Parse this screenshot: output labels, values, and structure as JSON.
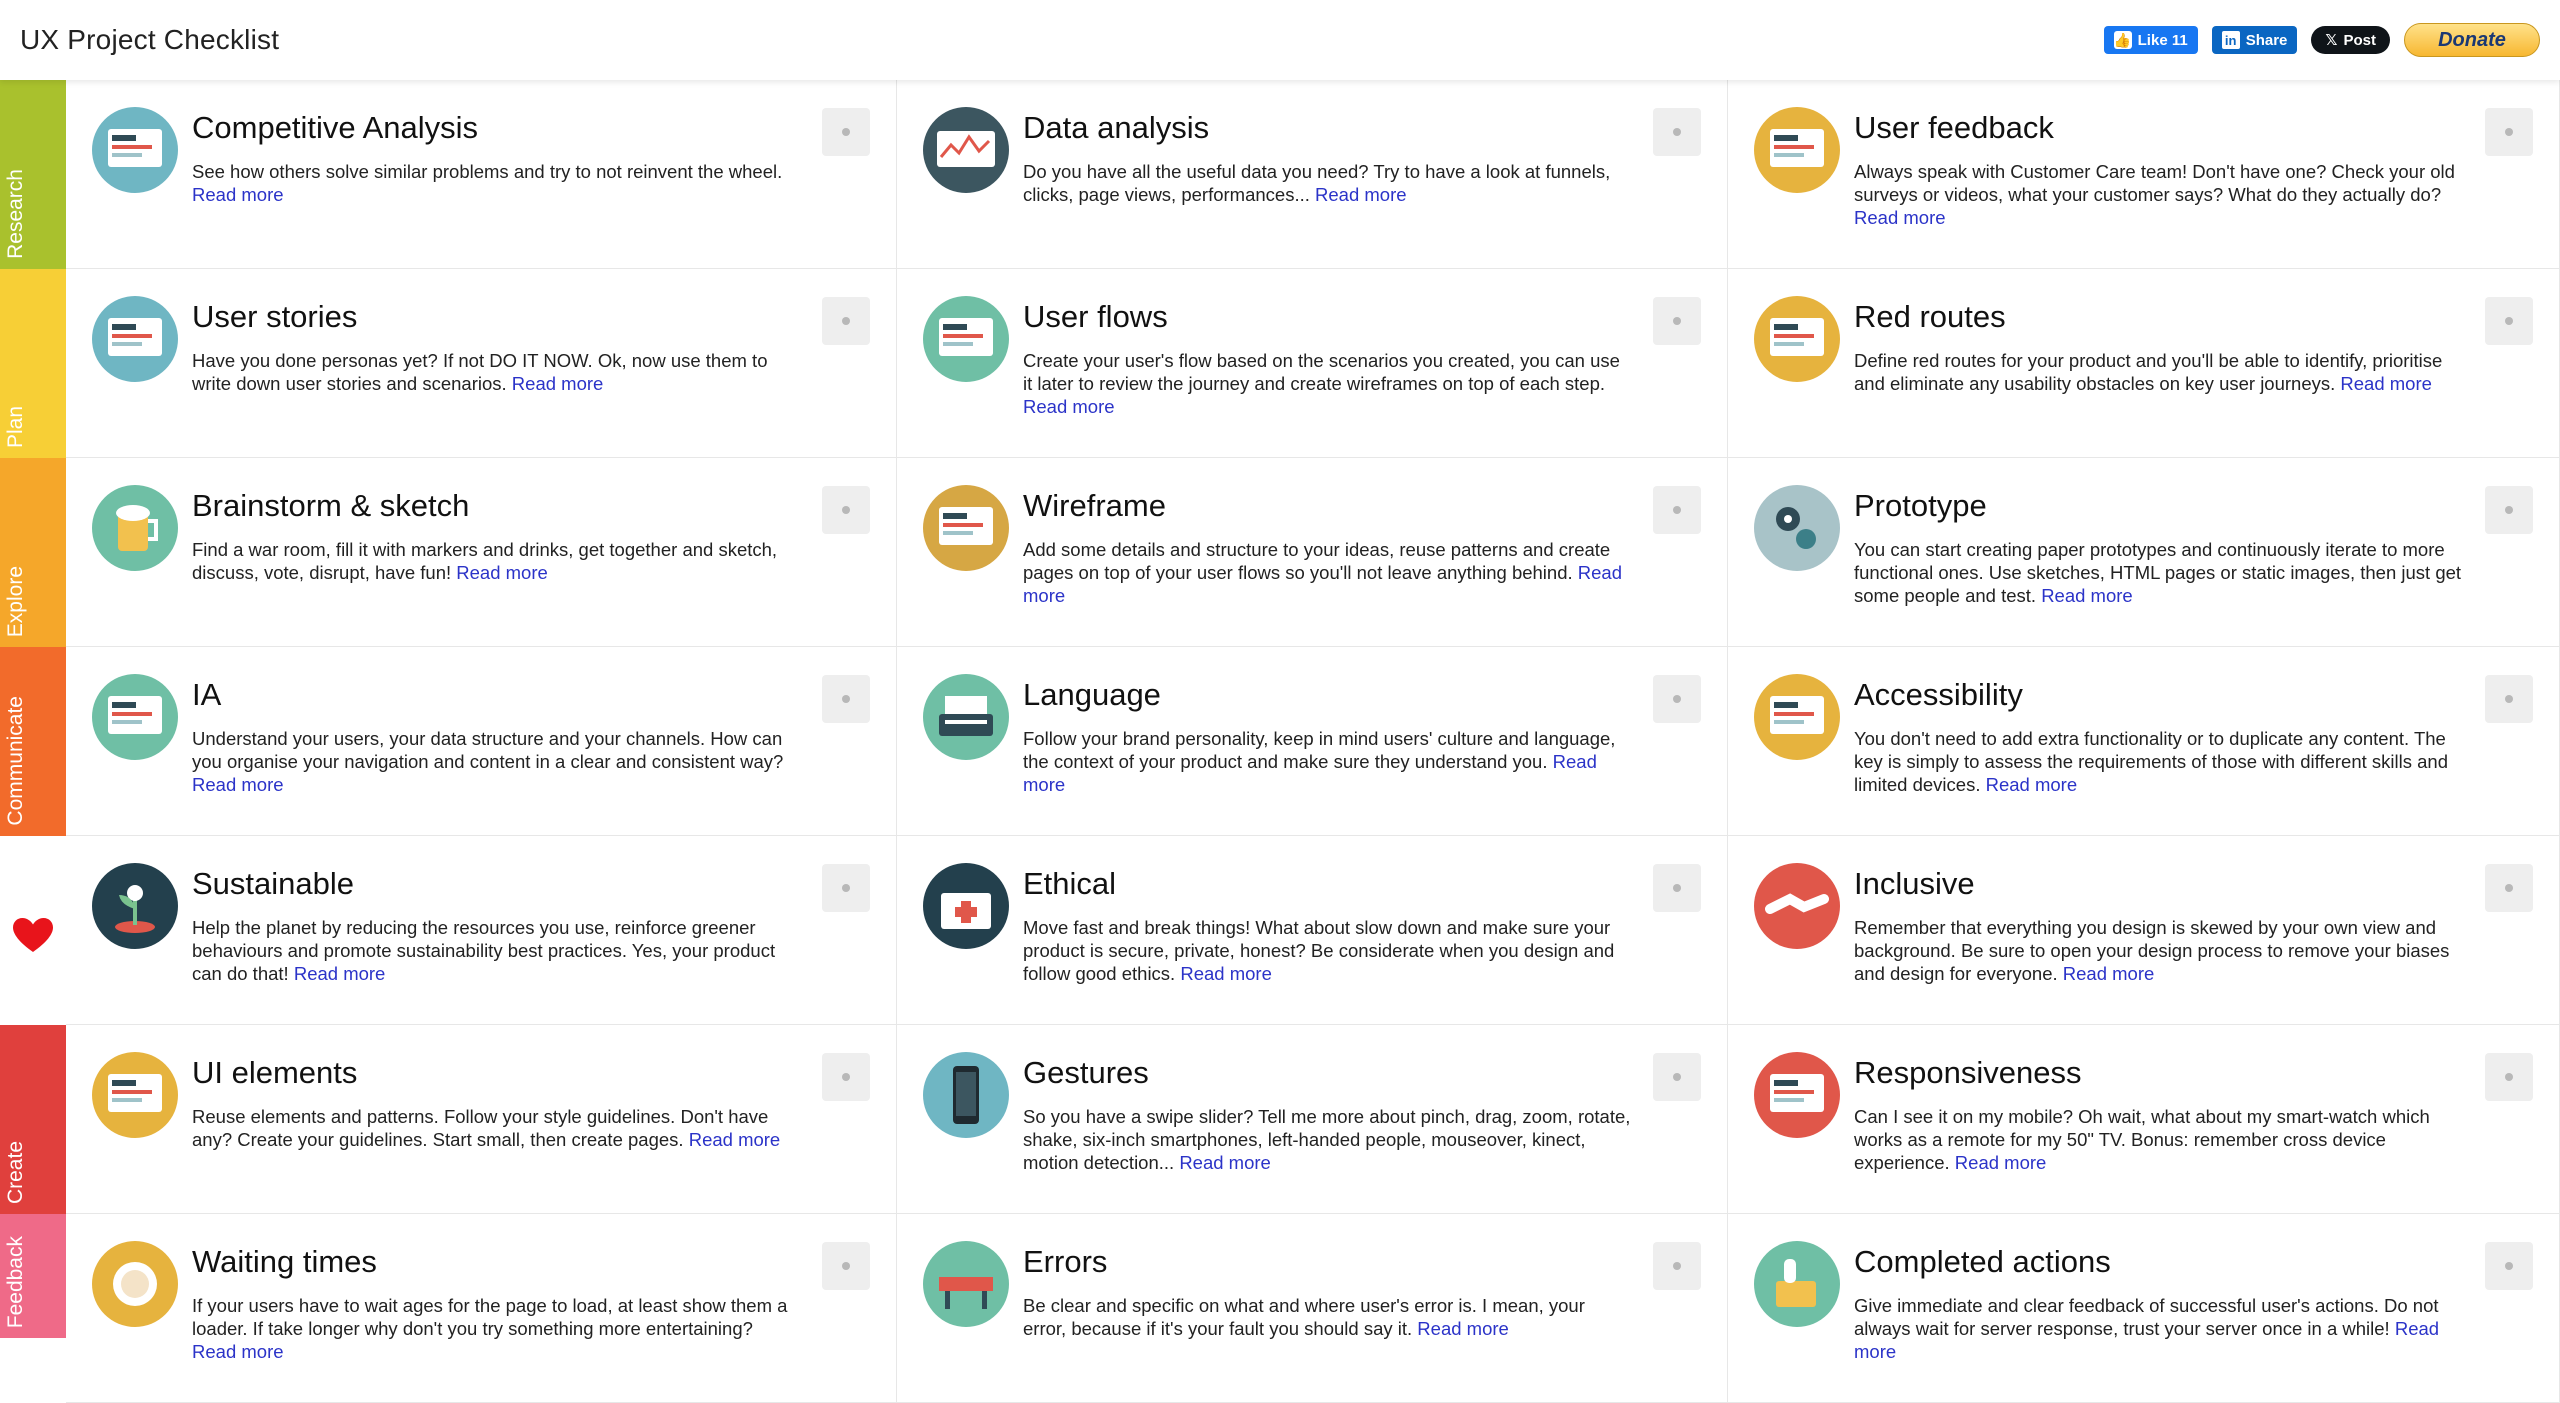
{
  "header": {
    "title": "UX Project Checklist",
    "social": {
      "like_label": "Like 11",
      "share_label": "Share",
      "post_label": "Post",
      "donate_label": "Donate"
    }
  },
  "sidebar": {
    "phases": [
      {
        "label": "Research",
        "color": "#a9c12d"
      },
      {
        "label": "Plan",
        "color": "#f7cf36"
      },
      {
        "label": "Explore",
        "color": "#f5a72a"
      },
      {
        "label": "Communicate",
        "color": "#f26b2b"
      },
      {
        "label": "",
        "color": "#ffffff",
        "icon": "heart-icon"
      },
      {
        "label": "Create",
        "color": "#e0403d"
      },
      {
        "label": "Feedback",
        "color": "#ef6a88"
      }
    ]
  },
  "cards": [
    {
      "title": "Competitive Analysis",
      "desc": "See how others solve similar problems and try to not reinvent the wheel.",
      "read_more": "Read more",
      "icon": "dashboard-screens-icon",
      "icon_color": "#6fb6c3"
    },
    {
      "title": "Data analysis",
      "desc": "Do you have all the useful data you need? Try to have a look at funnels, clicks, page views, performances...",
      "read_more": "Read more",
      "icon": "analytics-monitor-icon",
      "icon_color": "#3c5660"
    },
    {
      "title": "User feedback",
      "desc": "Always speak with Customer Care team! Don't have one? Check your old surveys or videos, what your customer says? What do they actually do?",
      "read_more": "Read more",
      "icon": "feedback-docs-icon",
      "icon_color": "#e6b33e"
    },
    {
      "title": "User stories",
      "desc": "Have you done personas yet? If not DO IT NOW. Ok, now use them to write down user stories and scenarios.",
      "read_more": "Read more",
      "icon": "persona-card-icon",
      "icon_color": "#6fb6c3"
    },
    {
      "title": "User flows",
      "desc": "Create your user's flow based on the scenarios you created, you can use it later to review the journey and create wireframes on top of each step.",
      "read_more": "Read more",
      "icon": "flow-chart-icon",
      "icon_color": "#6fbfa5"
    },
    {
      "title": "Red routes",
      "desc": "Define red routes for your product and you'll be able to identify, prioritise and eliminate any usability obstacles on key user journeys.",
      "read_more": "Read more",
      "icon": "browser-window-icon",
      "icon_color": "#e6b33e"
    },
    {
      "title": "Brainstorm & sketch",
      "desc": "Find a war room, fill it with markers and drinks, get together and sketch, discuss, vote, disrupt, have fun!",
      "read_more": "Read more",
      "icon": "beer-mug-icon",
      "icon_color": "#6fbfa5"
    },
    {
      "title": "Wireframe",
      "desc": "Add some details and structure to your ideas, reuse patterns and create pages on top of your user flows so you'll not leave anything behind.",
      "read_more": "Read more",
      "icon": "pencil-sketch-icon",
      "icon_color": "#d6a744"
    },
    {
      "title": "Prototype",
      "desc": "You can start creating paper prototypes and continuously iterate to more functional ones. Use sketches, HTML pages or static images, then just get some people and test.",
      "read_more": "Read more",
      "icon": "gears-icon",
      "icon_color": "#a8c3c8"
    },
    {
      "title": "IA",
      "desc": "Understand your users, your data structure and your channels. How can you organise your navigation and content in a clear and consistent way?",
      "read_more": "Read more",
      "icon": "sitemap-icon",
      "icon_color": "#6fbfa5"
    },
    {
      "title": "Language",
      "desc": "Follow your brand personality, keep in mind users' culture and language, the context of your product and make sure they understand you.",
      "read_more": "Read more",
      "icon": "typewriter-icon",
      "icon_color": "#6fbfa5"
    },
    {
      "title": "Accessibility",
      "desc": "You don't need to add extra functionality or to duplicate any content. The key is simply to assess the requirements of those with different skills and limited devices.",
      "read_more": "Read more",
      "icon": "armchair-icon",
      "icon_color": "#e6b33e"
    },
    {
      "title": "Sustainable",
      "desc": "Help the planet by reducing the resources you use, reinforce greener behaviours and promote sustainability best practices. Yes, your product can do that!",
      "read_more": "Read more",
      "icon": "plant-icon",
      "icon_color": "#23404d"
    },
    {
      "title": "Ethical",
      "desc": "Move fast and break things! What about slow down and make sure your product is secure, private, honest? Be considerate when you design and follow good ethics.",
      "read_more": "Read more",
      "icon": "first-aid-kit-icon",
      "icon_color": "#23404d"
    },
    {
      "title": "Inclusive",
      "desc": "Remember that everything you design is skewed by your own view and background. Be sure to open your design process to remove your biases and design for everyone.",
      "read_more": "Read more",
      "icon": "handshake-icon",
      "icon_color": "#e0574a"
    },
    {
      "title": "UI elements",
      "desc": "Reuse elements and patterns. Follow your style guidelines. Don't have any? Create your guidelines. Start small, then create pages.",
      "read_more": "Read more",
      "icon": "form-window-icon",
      "icon_color": "#e6b33e"
    },
    {
      "title": "Gestures",
      "desc": "So you have a swipe slider? Tell me more about pinch, drag, zoom, rotate, shake, six-inch smartphones, left-handed people, mouseover, kinect, motion detection...",
      "read_more": "Read more",
      "icon": "smartphone-icon",
      "icon_color": "#6fb6c3"
    },
    {
      "title": "Responsiveness",
      "desc": "Can I see it on my mobile? Oh wait, what about my smart-watch which works as a remote for my 50\" TV. Bonus: remember cross device experience.",
      "read_more": "Read more",
      "icon": "devices-icon",
      "icon_color": "#e0574a"
    },
    {
      "title": "Waiting times",
      "desc": "If your users have to wait ages for the page to load, at least show them a loader. If take longer why don't you try something more entertaining?",
      "read_more": "Read more",
      "icon": "plate-icon",
      "icon_color": "#e6b33e"
    },
    {
      "title": "Errors",
      "desc": "Be clear and specific on what and where user's error is. I mean, your error, because if it's your fault you should say it.",
      "read_more": "Read more",
      "icon": "road-block-icon",
      "icon_color": "#6fbfa5"
    },
    {
      "title": "Completed actions",
      "desc": "Give immediate and clear feedback of successful user's actions. Do not always wait for server response, trust your server once in a while!",
      "read_more": "Read more",
      "icon": "thumbs-up-icon",
      "icon_color": "#6fbfa5"
    }
  ]
}
